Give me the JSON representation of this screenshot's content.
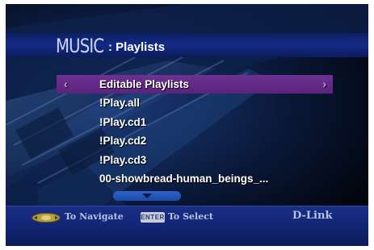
{
  "header": {
    "section": "MUSIC",
    "subtitle": ": Playlists"
  },
  "menu": {
    "items": [
      {
        "label": "Editable Playlists",
        "selected": true
      },
      {
        "label": "!Play.all",
        "selected": false
      },
      {
        "label": "!Play.cd1",
        "selected": false
      },
      {
        "label": "!Play.cd2",
        "selected": false
      },
      {
        "label": "!Play.cd3",
        "selected": false
      },
      {
        "label": "00-showbread-human_beings_...",
        "selected": false
      }
    ],
    "prev_arrow": "‹",
    "next_arrow": "›"
  },
  "footer": {
    "navigate_text": "To Navigate",
    "enter_key_label": "ENTER",
    "select_text": "To Select",
    "brand": "D-Link"
  },
  "colors": {
    "selection": "#6e3192",
    "header_band": "#132b86",
    "footer_band": "#1a2f86",
    "scroll_pill": "#2c64c8"
  },
  "icons": {
    "navigate": "dpad-icon",
    "scroll": "scroll-down-icon"
  }
}
